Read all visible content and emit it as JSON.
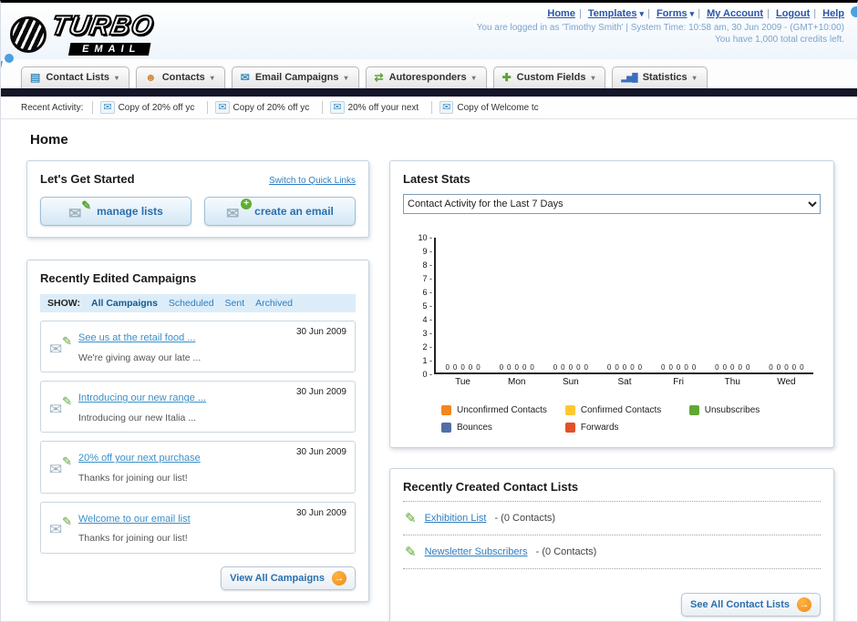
{
  "colors": {
    "accent_orange": "#f08a12",
    "link_blue": "#2f7cc0",
    "dark_bar": "#16162a"
  },
  "icons": {
    "caret": "▾",
    "envelope": "✉",
    "pencil": "✎",
    "plus": "+",
    "arrow": "→",
    "bars": "▂▅█",
    "grid_plus": "✚",
    "list": "▤",
    "person": "☻",
    "reply": "⇄"
  },
  "header": {
    "logo_title": "TURBO",
    "logo_subtitle": "EMAIL",
    "nav": [
      {
        "label": "Home",
        "caret": false
      },
      {
        "label": "Templates",
        "caret": true
      },
      {
        "label": "Forms",
        "caret": true
      },
      {
        "label": "My Account",
        "caret": false
      },
      {
        "label": "Logout",
        "caret": false
      },
      {
        "label": "Help",
        "caret": false
      }
    ],
    "login_info": "You are logged in as 'Timothy Smith' | System Time: 10:58 am, 30 Jun 2009 - (GMT+10:00)",
    "credits_info": "You have 1,000 total credits left."
  },
  "tabs": [
    {
      "label": "Contact Lists"
    },
    {
      "label": "Contacts"
    },
    {
      "label": "Email Campaigns"
    },
    {
      "label": "Autoresponders"
    },
    {
      "label": "Custom Fields"
    },
    {
      "label": "Statistics"
    }
  ],
  "recent_activity": {
    "label": "Recent Activity:",
    "items": [
      "Copy of 20% off yc",
      "Copy of 20% off yc",
      "20% off your next",
      "Copy of Welcome tc"
    ]
  },
  "page_title": "Home",
  "get_started": {
    "title": "Let's Get Started",
    "switch_link": "Switch to Quick Links",
    "manage_lists_label": "manage lists",
    "create_email_label": "create an email"
  },
  "campaigns": {
    "title": "Recently Edited Campaigns",
    "show_label": "SHOW:",
    "filters": [
      "All Campaigns",
      "Scheduled",
      "Sent",
      "Archived"
    ],
    "items": [
      {
        "title": "See us at the retail food ...",
        "subtitle": "We're giving away our late ...",
        "date": "30 Jun 2009"
      },
      {
        "title": "Introducing our new range ...",
        "subtitle": "Introducing our new Italia ...",
        "date": "30 Jun 2009"
      },
      {
        "title": "20% off your next purchase",
        "subtitle": "Thanks for joining our list!",
        "date": "30 Jun 2009"
      },
      {
        "title": "Welcome to our email list",
        "subtitle": "Thanks for joining our list!",
        "date": "30 Jun 2009"
      }
    ],
    "view_all_label": "View All Campaigns"
  },
  "stats": {
    "title": "Latest Stats",
    "dropdown_value": "Contact Activity for the Last 7 Days",
    "chart_data": {
      "type": "bar",
      "title": "Contact Activity for the Last 7 Days",
      "categories": [
        "Tue",
        "Mon",
        "Sun",
        "Sat",
        "Fri",
        "Thu",
        "Wed"
      ],
      "series": [
        {
          "name": "Unconfirmed Contacts",
          "color": "#f5861f",
          "values": [
            0,
            0,
            0,
            0,
            0,
            0,
            0
          ]
        },
        {
          "name": "Confirmed Contacts",
          "color": "#fdc82f",
          "values": [
            0,
            0,
            0,
            0,
            0,
            0,
            0
          ]
        },
        {
          "name": "Unsubscribes",
          "color": "#61a832",
          "values": [
            0,
            0,
            0,
            0,
            0,
            0,
            0
          ]
        },
        {
          "name": "Bounces",
          "color": "#4f6fa8",
          "values": [
            0,
            0,
            0,
            0,
            0,
            0,
            0
          ]
        },
        {
          "name": "Forwards",
          "color": "#e2512a",
          "values": [
            0,
            0,
            0,
            0,
            0,
            0,
            0
          ]
        }
      ],
      "ylim": [
        0,
        10
      ],
      "yticks": [
        10,
        9,
        8,
        7,
        6,
        5,
        4,
        3,
        2,
        1,
        0
      ],
      "grid": false,
      "legend_position": "bottom",
      "xlabel": "",
      "ylabel": ""
    }
  },
  "contact_lists": {
    "title": "Recently Created Contact Lists",
    "items": [
      {
        "name": "Exhibition List",
        "count": "- (0 Contacts)"
      },
      {
        "name": "Newsletter Subscribers",
        "count": "- (0 Contacts)"
      }
    ],
    "see_all_label": "See All Contact Lists"
  }
}
